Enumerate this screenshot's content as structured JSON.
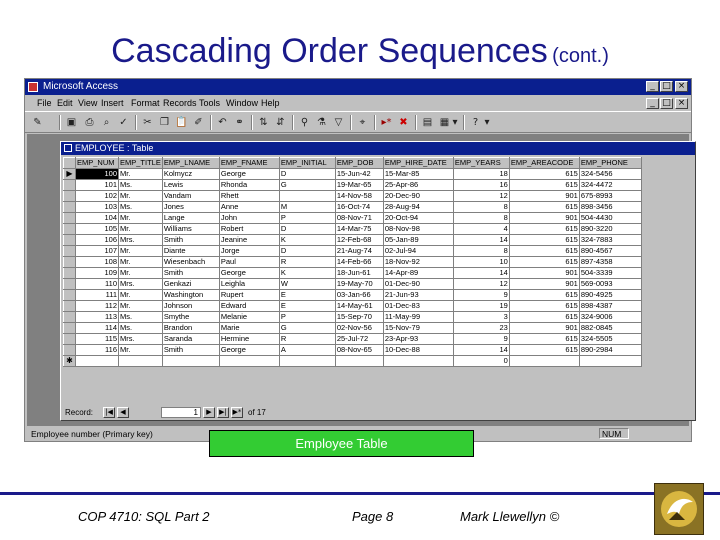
{
  "slide": {
    "title": "Cascading Order Sequences",
    "title_suffix": "(cont.)",
    "caption": "Employee Table",
    "footer_left": "COP 4710: SQL Part 2",
    "footer_center": "Page 8",
    "footer_right": "Mark Llewellyn ©"
  },
  "window": {
    "title": "Microsoft Access",
    "menu": [
      "File",
      "Edit",
      "View",
      "Insert",
      "Format",
      "Records",
      "Tools",
      "Window",
      "Help"
    ],
    "status_text": "Employee number (Primary key)",
    "status_num": "NUM"
  },
  "table_window": {
    "title": "EMPLOYEE : Table"
  },
  "grid": {
    "columns": [
      "EMP_NUM",
      "EMP_TITLE",
      "EMP_LNAME",
      "EMP_FNAME",
      "EMP_INITIAL",
      "EMP_DOB",
      "EMP_HIRE_DATE",
      "EMP_YEARS",
      "EMP_AREACODE",
      "EMP_PHONE"
    ],
    "rows": [
      [
        "100",
        "Mr.",
        "Kolmycz",
        "George",
        "D",
        "15-Jun-42",
        "15-Mar-85",
        "18",
        "615",
        "324-5456"
      ],
      [
        "101",
        "Ms.",
        "Lewis",
        "Rhonda",
        "G",
        "19-Mar-65",
        "25-Apr-86",
        "16",
        "615",
        "324-4472"
      ],
      [
        "102",
        "Mr.",
        "Vandam",
        "Rhett",
        "",
        "14-Nov-58",
        "20-Dec-90",
        "12",
        "901",
        "675-8993"
      ],
      [
        "103",
        "Ms.",
        "Jones",
        "Anne",
        "M",
        "16-Oct-74",
        "28-Aug-94",
        "8",
        "615",
        "898-3456"
      ],
      [
        "104",
        "Mr.",
        "Lange",
        "John",
        "P",
        "08-Nov-71",
        "20-Oct-94",
        "8",
        "901",
        "504-4430"
      ],
      [
        "105",
        "Mr.",
        "Williams",
        "Robert",
        "D",
        "14-Mar-75",
        "08-Nov-98",
        "4",
        "615",
        "890-3220"
      ],
      [
        "106",
        "Mrs.",
        "Smith",
        "Jeanine",
        "K",
        "12-Feb-68",
        "05-Jan-89",
        "14",
        "615",
        "324-7883"
      ],
      [
        "107",
        "Mr.",
        "Diante",
        "Jorge",
        "D",
        "21-Aug-74",
        "02-Jul-94",
        "8",
        "615",
        "890-4567"
      ],
      [
        "108",
        "Mr.",
        "Wiesenbach",
        "Paul",
        "R",
        "14-Feb-66",
        "18-Nov-92",
        "10",
        "615",
        "897-4358"
      ],
      [
        "109",
        "Mr.",
        "Smith",
        "George",
        "K",
        "18-Jun-61",
        "14-Apr-89",
        "14",
        "901",
        "504-3339"
      ],
      [
        "110",
        "Mrs.",
        "Genkazi",
        "Leighla",
        "W",
        "19-May-70",
        "01-Dec-90",
        "12",
        "901",
        "569-0093"
      ],
      [
        "111",
        "Mr.",
        "Washington",
        "Rupert",
        "E",
        "03-Jan-66",
        "21-Jun-93",
        "9",
        "615",
        "890-4925"
      ],
      [
        "112",
        "Mr.",
        "Johnson",
        "Edward",
        "E",
        "14-May-61",
        "01-Dec-83",
        "19",
        "615",
        "898-4387"
      ],
      [
        "113",
        "Ms.",
        "Smythe",
        "Melanie",
        "P",
        "15-Sep-70",
        "11-May-99",
        "3",
        "615",
        "324-9006"
      ],
      [
        "114",
        "Ms.",
        "Brandon",
        "Marie",
        "G",
        "02-Nov-56",
        "15-Nov-79",
        "23",
        "901",
        "882-0845"
      ],
      [
        "115",
        "Mrs.",
        "Saranda",
        "Hermine",
        "R",
        "25-Jul-72",
        "23-Apr-93",
        "9",
        "615",
        "324-5505"
      ],
      [
        "116",
        "Mr.",
        "Smith",
        "George",
        "A",
        "08-Nov-65",
        "10-Dec-88",
        "14",
        "615",
        "890-2984"
      ]
    ],
    "new_row_years": "0"
  },
  "navigation": {
    "label": "Record:",
    "current": "1",
    "of_text": "of 17"
  }
}
